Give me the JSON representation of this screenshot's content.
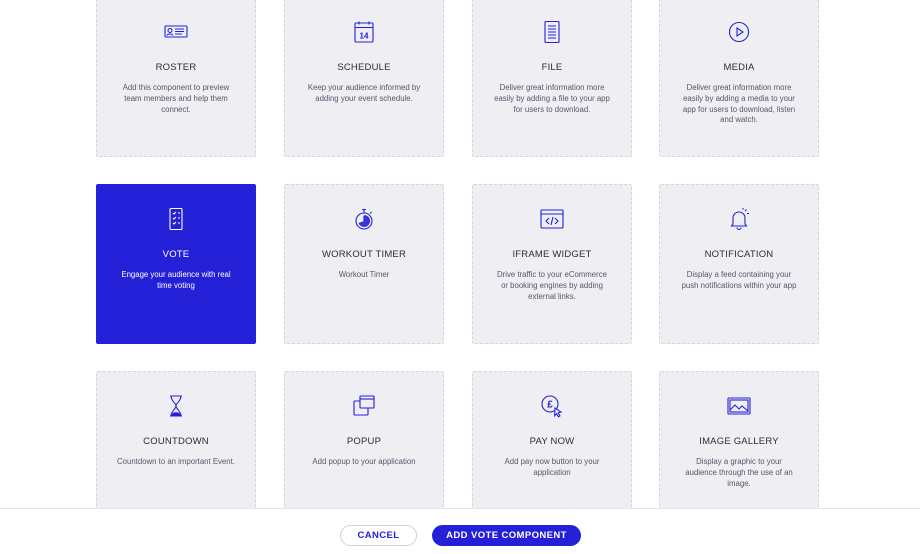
{
  "colors": {
    "accent": "#2420d8",
    "card_bg": "#efeff3"
  },
  "components": [
    {
      "title": "ROSTER",
      "desc": "Add this component to preview team members and help them connect.",
      "icon": "roster-icon"
    },
    {
      "title": "SCHEDULE",
      "desc": "Keep your audience informed by adding your event schedule.",
      "icon": "calendar-icon",
      "icon_text": "14"
    },
    {
      "title": "FILE",
      "desc": "Deliver great information more easily by adding a file to your app for users to download.",
      "icon": "file-icon"
    },
    {
      "title": "MEDIA",
      "desc": "Deliver great information more easily by adding a media to your app for users to download, listen and watch.",
      "icon": "play-icon"
    },
    {
      "title": "VOTE",
      "desc": "Engage your audience with real time voting",
      "icon": "vote-icon",
      "selected": true
    },
    {
      "title": "WORKOUT TIMER",
      "desc": "Workout Timer",
      "icon": "stopwatch-icon"
    },
    {
      "title": "IFRAME WIDGET",
      "desc": "Drive traffic to your eCommerce or booking engines by adding external links.",
      "icon": "code-window-icon"
    },
    {
      "title": "NOTIFICATION",
      "desc": "Display a feed containing your push notifications within your app",
      "icon": "bell-icon"
    },
    {
      "title": "COUNTDOWN",
      "desc": "Countdown to an important Event.",
      "icon": "hourglass-icon"
    },
    {
      "title": "POPUP",
      "desc": "Add popup to your application",
      "icon": "popup-icon"
    },
    {
      "title": "PAY NOW",
      "desc": "Add pay now button to your application",
      "icon": "pound-click-icon",
      "icon_text": "£"
    },
    {
      "title": "IMAGE GALLERY",
      "desc": "Display a graphic to your audience through the use of an image.",
      "icon": "image-icon"
    }
  ],
  "footer": {
    "cancel_label": "CANCEL",
    "add_label": "ADD VOTE COMPONENT"
  }
}
